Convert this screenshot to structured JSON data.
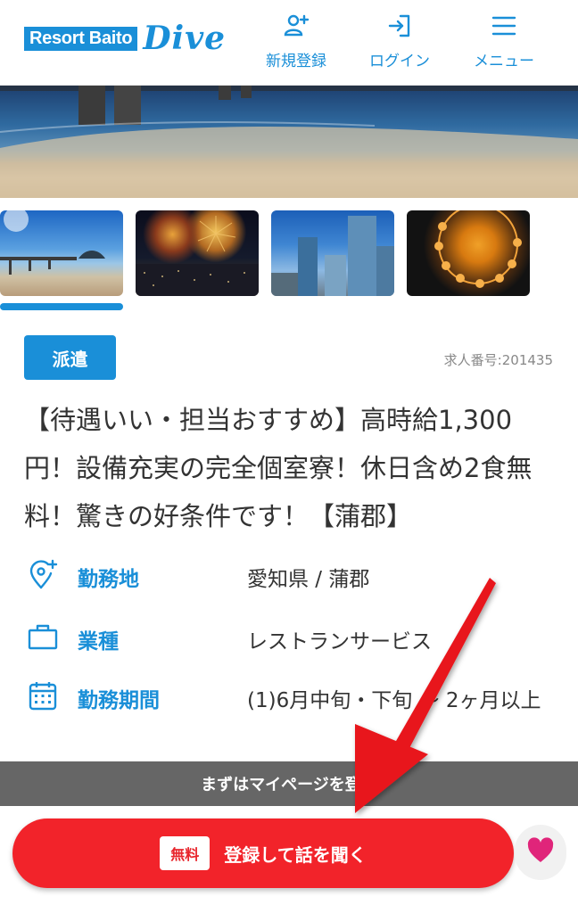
{
  "header": {
    "logo_box_text": "Resort Baito",
    "logo_script_text": "Dive",
    "nav": {
      "register_label": "新規登録",
      "login_label": "ログイン",
      "menu_label": "メニュー"
    }
  },
  "gallery": {
    "thumbnail_icons": [
      "beach-pier-photo",
      "fireworks-night-photo",
      "city-towers-photo",
      "ferris-wheel-photo"
    ]
  },
  "job": {
    "tag": "派遣",
    "number": "求人番号:201435",
    "title": "【待遇いい・担当おすすめ】高時給1,300円！設備充実の完全個室寮！休日含め2食無料！驚きの好条件です！【蒲郡】",
    "details": {
      "location_label": "勤務地",
      "location_value": "愛知県 / 蒲郡",
      "type_label": "業種",
      "type_value": "レストランサービス",
      "period_label": "勤務期間",
      "period_value": "(1)6月中旬・下旬 〜 2ヶ月以上"
    }
  },
  "footer": {
    "mypage_text": "まずはマイページを登録",
    "cta_badge": "無料",
    "cta_label": "登録して話を聞く"
  },
  "colors": {
    "brand_blue": "#1a8fd8",
    "cta_red": "#f2232a",
    "heart_pink": "#e0257a",
    "annotation_arrow": "#e8141b"
  }
}
